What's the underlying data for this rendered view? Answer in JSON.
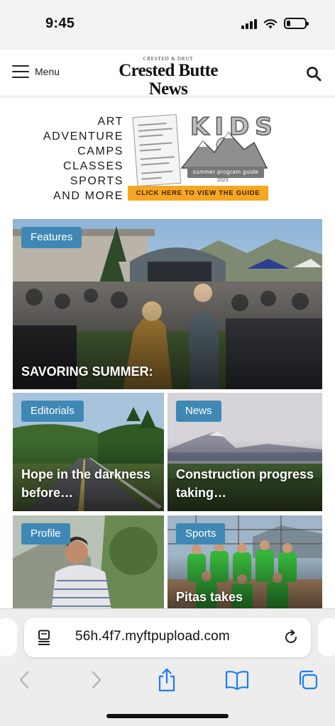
{
  "status_bar": {
    "time": "9:45",
    "icons": [
      "cellular-signal-icon",
      "wifi-icon",
      "battery-icon"
    ],
    "battery_level": 0.2
  },
  "header": {
    "menu_label": "Menu",
    "logo_kicker": "CRESTED & DRUT",
    "logo_title": "Crested Butte News",
    "search_icon": "search-icon"
  },
  "ad": {
    "lines": [
      "ART",
      "ADVENTURE",
      "CAMPS",
      "CLASSES",
      "SPORTS",
      "AND MORE"
    ],
    "kids_title": "KIDS",
    "guide_label": "summer program guide",
    "year": "2023",
    "cta": "CLICK HERE TO VIEW THE GUIDE",
    "accent_color": "#f5a623"
  },
  "articles": [
    {
      "category": "Features",
      "title": "SAVORING SUMMER:"
    },
    {
      "category": "Editorials",
      "title": "Hope in the darkness before…"
    },
    {
      "category": "News",
      "title": "Construction progress taking…"
    },
    {
      "category": "Profile",
      "title": ""
    },
    {
      "category": "Sports",
      "title": "Pitas takes"
    }
  ],
  "badge_color": "#3f88b5",
  "browser": {
    "url": "56h.4f7.myftpupload.com",
    "buttons": [
      "back-icon",
      "forward-icon",
      "share-icon",
      "bookmarks-icon",
      "tabs-icon"
    ]
  }
}
